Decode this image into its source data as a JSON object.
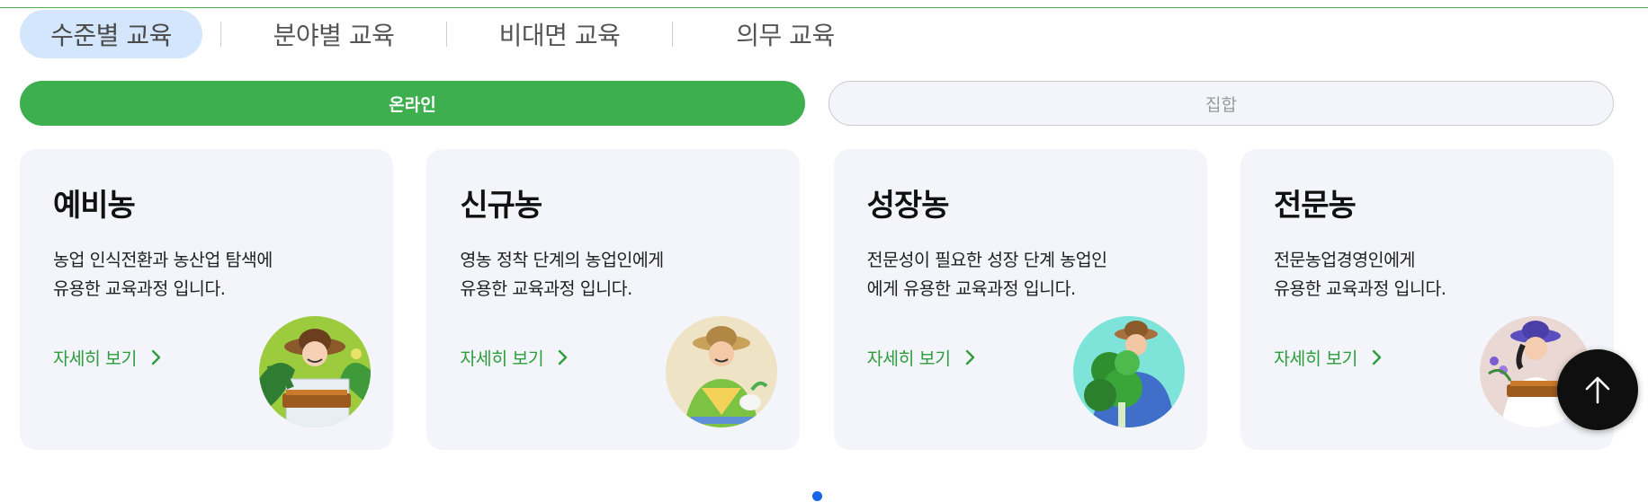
{
  "category_tabs": [
    {
      "label": "수준별 교육",
      "active": true
    },
    {
      "label": "분야별 교육",
      "active": false
    },
    {
      "label": "비대면 교육",
      "active": false
    },
    {
      "label": "의무 교육",
      "active": false
    }
  ],
  "mode_toggle": {
    "online_label": "온라인",
    "group_label": "집합",
    "selected": "온라인"
  },
  "cards": [
    {
      "title": "예비농",
      "desc_line1": "농업 인식전환과 농산업 탐색에",
      "desc_line2": "유용한 교육과정 입니다.",
      "link_label": "자세히 보기",
      "avatar_icon": "farmer-with-basket-icon"
    },
    {
      "title": "신규농",
      "desc_line1": "영농 정착 단계의 농업인에게",
      "desc_line2": "유용한 교육과정 입니다.",
      "link_label": "자세히 보기",
      "avatar_icon": "farmer-planting-icon"
    },
    {
      "title": "성장농",
      "desc_line1": "전문성이 필요한 성장 단계 농업인",
      "desc_line2": "에게 유용한 교육과정 입니다.",
      "link_label": "자세히 보기",
      "avatar_icon": "farmer-holding-greens-icon"
    },
    {
      "title": "전문농",
      "desc_line1": "전문농업경영인에게",
      "desc_line2": "유용한 교육과정 입니다.",
      "link_label": "자세히 보기",
      "avatar_icon": "farmer-with-flower-basket-icon"
    }
  ],
  "pagination": {
    "current": 1
  },
  "colors": {
    "accent_green": "#3eaf4f",
    "link_green": "#2e9d3d",
    "active_tab_bg": "#d3e6fb",
    "card_bg": "#f4f5fa",
    "dot_blue": "#1565e8"
  }
}
